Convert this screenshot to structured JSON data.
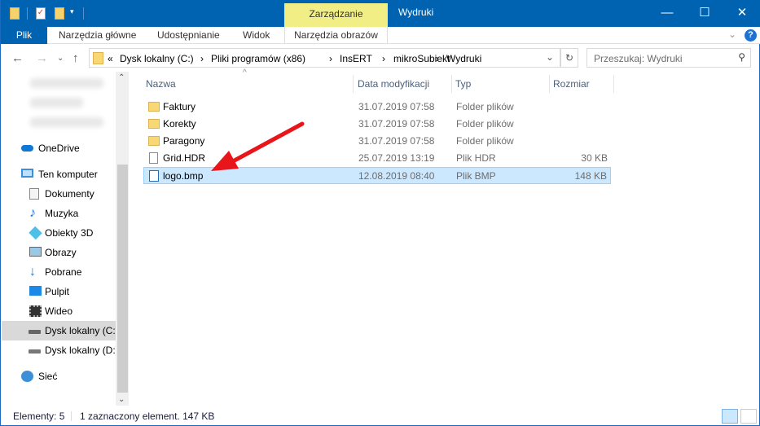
{
  "window": {
    "title": "Wydruki",
    "context_tab": "Zarządzanie"
  },
  "ribbon": {
    "tabs": [
      "Plik",
      "Narzędzia główne",
      "Udostępnianie",
      "Widok",
      "Narzędzia obrazów"
    ]
  },
  "address": {
    "prefix": "«",
    "crumbs": [
      "Dysk lokalny (C:)",
      "Pliki programów (x86)",
      "InsERT",
      "mikroSubiekt",
      "Wydruki"
    ]
  },
  "search": {
    "placeholder": "Przeszukaj: Wydruki"
  },
  "sidebar": {
    "items": [
      {
        "label": "OneDrive",
        "icon": "onedrive-icon"
      },
      {
        "label": "Ten komputer",
        "icon": "computer-icon"
      },
      {
        "label": "Dokumenty",
        "icon": "documents-icon"
      },
      {
        "label": "Muzyka",
        "icon": "music-icon"
      },
      {
        "label": "Obiekty 3D",
        "icon": "objects-3d-icon"
      },
      {
        "label": "Obrazy",
        "icon": "pictures-icon"
      },
      {
        "label": "Pobrane",
        "icon": "downloads-icon"
      },
      {
        "label": "Pulpit",
        "icon": "desktop-icon"
      },
      {
        "label": "Wideo",
        "icon": "video-icon"
      },
      {
        "label": "Dysk lokalny (C:)",
        "icon": "drive-icon"
      },
      {
        "label": "Dysk lokalny (D:)",
        "icon": "drive-icon"
      },
      {
        "label": "Sieć",
        "icon": "network-icon"
      }
    ]
  },
  "columns": [
    "Nazwa",
    "Data modyfikacji",
    "Typ",
    "Rozmiar"
  ],
  "files": [
    {
      "name": "Faktury",
      "date": "31.07.2019 07:58",
      "type": "Folder plików",
      "size": ""
    },
    {
      "name": "Korekty",
      "date": "31.07.2019 07:58",
      "type": "Folder plików",
      "size": ""
    },
    {
      "name": "Paragony",
      "date": "31.07.2019 07:58",
      "type": "Folder plików",
      "size": ""
    },
    {
      "name": "Grid.HDR",
      "date": "25.07.2019 13:19",
      "type": "Plik HDR",
      "size": "30 KB"
    },
    {
      "name": "logo.bmp",
      "date": "12.08.2019 08:40",
      "type": "Plik BMP",
      "size": "148 KB"
    }
  ],
  "status": {
    "count": "Elementy: 5",
    "selection": "1 zaznaczony element. 147 KB"
  },
  "colors": {
    "titlebar": "#0063b1",
    "context": "#f0ee84",
    "selection": "#cce8ff",
    "arrow": "#e8161b"
  }
}
